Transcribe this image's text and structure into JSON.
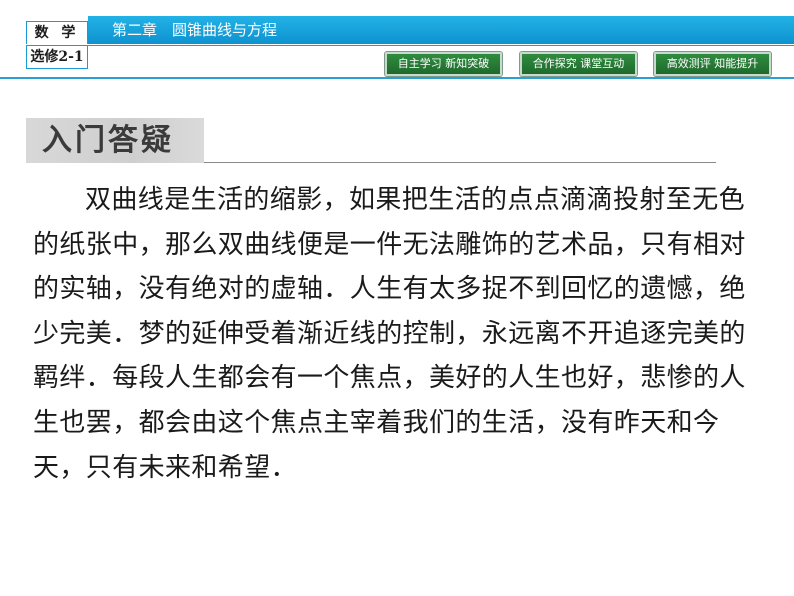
{
  "header": {
    "subject": "数 学",
    "elective": "选修2-1",
    "chapter_title": "第二章　圆锥曲线与方程"
  },
  "nav": {
    "items": [
      {
        "label": "自主学习  新知突破"
      },
      {
        "label": "合作探究  课堂互动"
      },
      {
        "label": "高效测评  知能提升"
      }
    ]
  },
  "section": {
    "heading": "入门答疑"
  },
  "content": {
    "paragraph": "双曲线是生活的缩影，如果把生活的点点滴滴投射至无色的纸张中，那么双曲线便是一件无法雕饰的艺术品，只有相对的实轴，没有绝对的虚轴．人生有太多捉不到回忆的遗憾，绝少完美．梦的延伸受着渐近线的控制，永远离不开追逐完美的羁绊．每段人生都会有一个焦点，美好的人生也好，悲惨的人生也罢，都会由这个焦点主宰着我们的生活，没有昨天和今天，只有未来和希望．"
  },
  "colors": {
    "header_blue": "#1a9ad6",
    "nav_green": "#2f8c3f",
    "heading_gray": "#d8d8d8"
  }
}
